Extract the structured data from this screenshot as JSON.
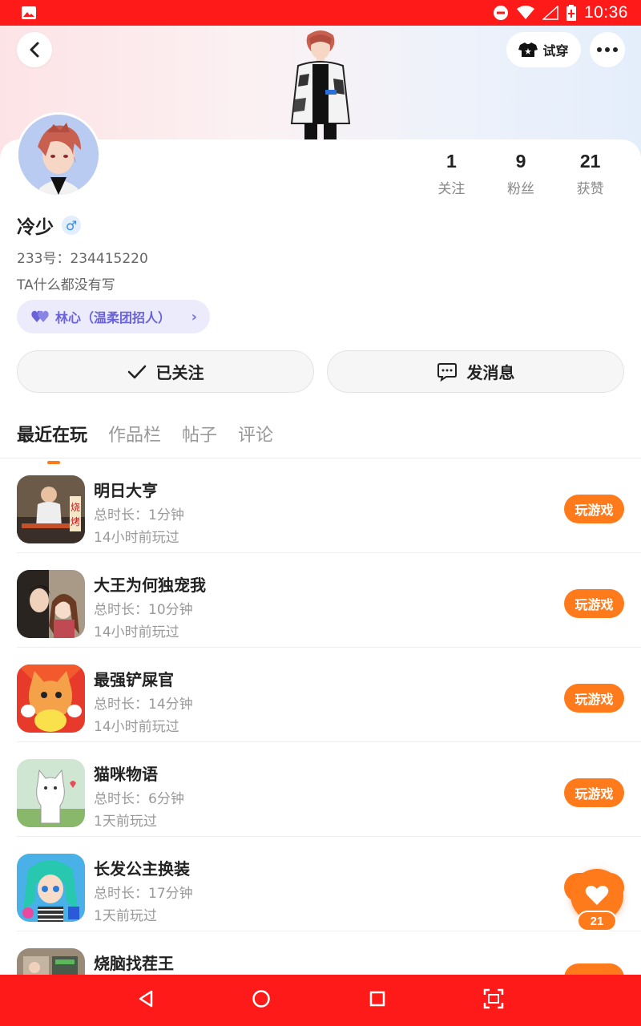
{
  "status_bar": {
    "time": "10:36"
  },
  "header": {
    "try_on_label": "试穿"
  },
  "profile": {
    "username": "冷少",
    "gender_symbol": "♂",
    "uid": "233号：234415220",
    "bio": "TA什么都没有写",
    "guild": "林心（温柔团招人）",
    "stats": [
      {
        "value": "1",
        "label": "关注"
      },
      {
        "value": "9",
        "label": "粉丝"
      },
      {
        "value": "21",
        "label": "获赞"
      }
    ]
  },
  "actions": {
    "follow_label": "已关注",
    "message_label": "发消息"
  },
  "tabs": [
    "最近在玩",
    "作品栏",
    "帖子",
    "评论"
  ],
  "games": [
    {
      "name": "明日大亨",
      "duration": "总时长：1分钟",
      "last_played": "14小时前玩过",
      "button": "玩游戏"
    },
    {
      "name": "大王为何独宠我",
      "duration": "总时长：10分钟",
      "last_played": "14小时前玩过",
      "button": "玩游戏"
    },
    {
      "name": "最强铲屎官",
      "duration": "总时长：14分钟",
      "last_played": "14小时前玩过",
      "button": "玩游戏"
    },
    {
      "name": "猫咪物语",
      "duration": "总时长：6分钟",
      "last_played": "1天前玩过",
      "button": "玩游戏"
    },
    {
      "name": "长发公主换装",
      "duration": "总时长：17分钟",
      "last_played": "1天前玩过",
      "button": "玩游戏"
    },
    {
      "name": "烧脑找茬王",
      "duration": "",
      "last_played": "",
      "button": ""
    }
  ],
  "fab": {
    "count": "21"
  },
  "colors": {
    "accent": "#ff7a1a",
    "status_bar": "#ff1a1a",
    "guild_bg": "#ecebfb"
  }
}
